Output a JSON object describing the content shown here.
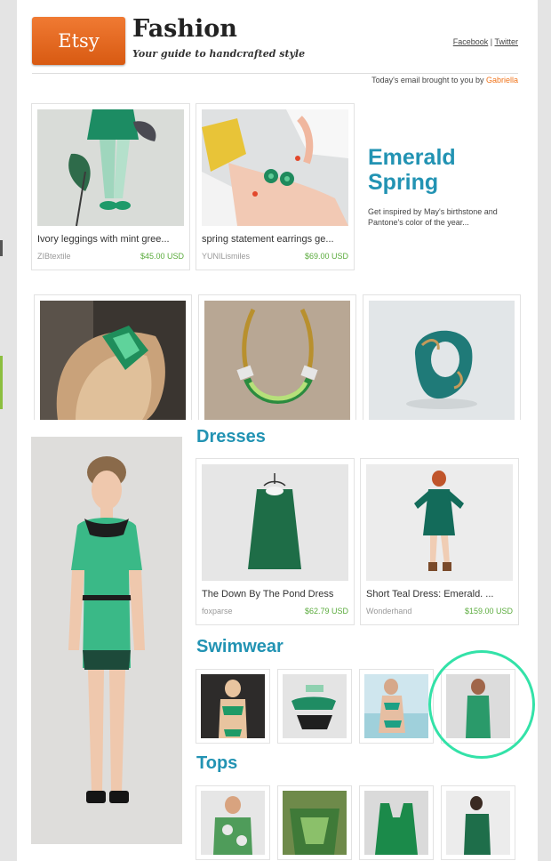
{
  "header": {
    "logo": "Etsy",
    "title": "Fashion",
    "tagline": "Your guide to handcrafted style",
    "social": {
      "facebook": "Facebook",
      "separator": "|",
      "twitter": "Twitter"
    },
    "brought_by": "Today's email brought to you by",
    "author": "Gabriella"
  },
  "feature": {
    "title": "Emerald Spring",
    "description": "Get inspired by May's birthstone and Pantone's color of the year..."
  },
  "top_items": [
    {
      "title": "Ivory leggings with mint gree...",
      "shop": "ZIBtextile",
      "price": "$45.00 USD"
    },
    {
      "title": "spring statement earrings ge...",
      "shop": "YUNILismiles",
      "price": "$69.00 USD"
    }
  ],
  "sections": {
    "dresses": {
      "heading": "Dresses",
      "items": [
        {
          "title": "The Down By The Pond Dress",
          "shop": "foxparse",
          "price": "$62.79 USD"
        },
        {
          "title": "Short Teal Dress: Emerald. ...",
          "shop": "Wonderhand",
          "price": "$159.00 USD"
        }
      ]
    },
    "swimwear": {
      "heading": "Swimwear"
    },
    "tops": {
      "heading": "Tops"
    }
  },
  "colors": {
    "accent": "#2293b3",
    "price": "#5aab3c",
    "etsy_orange": "#e8681f",
    "annotation": "#33e2a8"
  }
}
